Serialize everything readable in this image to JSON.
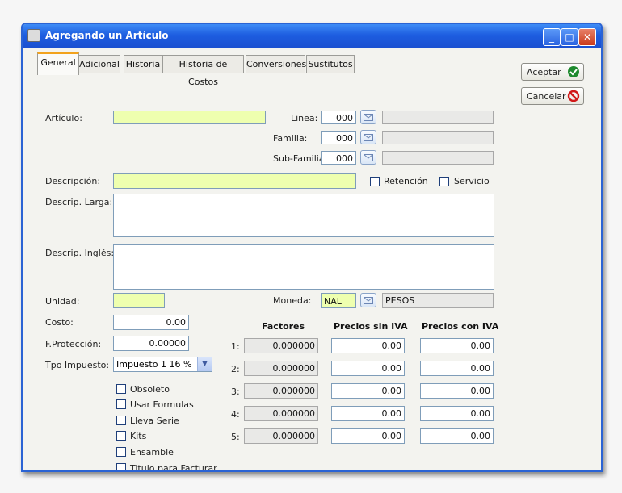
{
  "window": {
    "title": "Agregando un Artículo"
  },
  "tabs": [
    "General",
    "Adicional",
    "Historia",
    "Historia de Costos",
    "Conversiones",
    "Sustitutos"
  ],
  "buttons": {
    "accept": "Aceptar",
    "cancel": "Cancelar"
  },
  "labels": {
    "articulo": "Artículo:",
    "linea": "Linea:",
    "familia": "Familia:",
    "subfamilia": "Sub-Familia:",
    "descripcion": "Descripción:",
    "retencion": "Retención",
    "servicio": "Servicio",
    "descrip_larga": "Descrip. Larga:",
    "descrip_ingles": "Descrip. Inglés:",
    "unidad": "Unidad:",
    "moneda": "Moneda:",
    "costo": "Costo:",
    "fproteccion": "F.Protección:",
    "tpo_impuesto": "Tpo Impuesto:"
  },
  "values": {
    "linea": "000",
    "familia": "000",
    "subfamilia": "000",
    "moneda_code": "NAL",
    "moneda_name": "PESOS",
    "costo": "0.00",
    "fproteccion": "0.00000",
    "tpo_impuesto": "Impuesto 1 16 %"
  },
  "checkboxes": [
    "Obsoleto",
    "Usar Formulas",
    "Lleva Serie",
    "Kits",
    "Ensamble",
    "Titulo para Facturar"
  ],
  "prices": {
    "headers": {
      "factores": "Factores",
      "sin_iva": "Precios sin IVA",
      "con_iva": "Precios con IVA"
    },
    "rows": [
      {
        "label": "1:",
        "factor": "0.000000",
        "sin": "0.00",
        "con": "0.00"
      },
      {
        "label": "2:",
        "factor": "0.000000",
        "sin": "0.00",
        "con": "0.00"
      },
      {
        "label": "3:",
        "factor": "0.000000",
        "sin": "0.00",
        "con": "0.00"
      },
      {
        "label": "4:",
        "factor": "0.000000",
        "sin": "0.00",
        "con": "0.00"
      },
      {
        "label": "5:",
        "factor": "0.000000",
        "sin": "0.00",
        "con": "0.00"
      }
    ]
  }
}
